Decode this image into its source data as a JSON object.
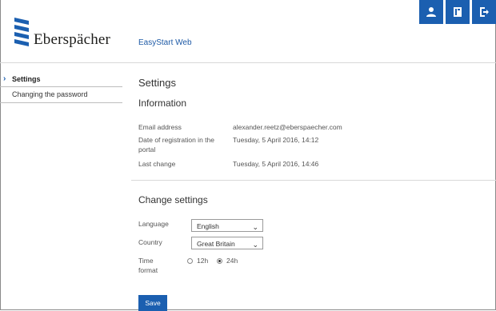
{
  "brand": {
    "name": "Eberspächer",
    "app_title": "EasyStart Web"
  },
  "header": {
    "actions": [
      {
        "icon": "user-icon"
      },
      {
        "icon": "document-icon"
      },
      {
        "icon": "logout-icon"
      }
    ]
  },
  "sidebar": {
    "items": [
      {
        "label": "Settings",
        "active": true
      },
      {
        "label": "Changing the password",
        "active": false
      }
    ]
  },
  "main": {
    "title": "Settings",
    "information": {
      "heading": "Information",
      "rows": [
        {
          "label": "Email address",
          "value": "alexander.reetz@eberspaecher.com"
        },
        {
          "label": "Date of registration in the portal",
          "value": "Tuesday, 5 April 2016, 14:12"
        },
        {
          "label": "Last change",
          "value": "Tuesday, 5 April 2016, 14:46"
        }
      ]
    },
    "change_settings": {
      "heading": "Change settings",
      "language_label": "Language",
      "language_value": "English",
      "country_label": "Country",
      "country_value": "Great Britain",
      "time_format_label": "Time format",
      "time_options": [
        "12h",
        "24h"
      ],
      "time_selected": "24h",
      "save_label": "Save"
    }
  },
  "colors": {
    "accent": "#1b5fb0",
    "divider": "#d9d9d9"
  }
}
